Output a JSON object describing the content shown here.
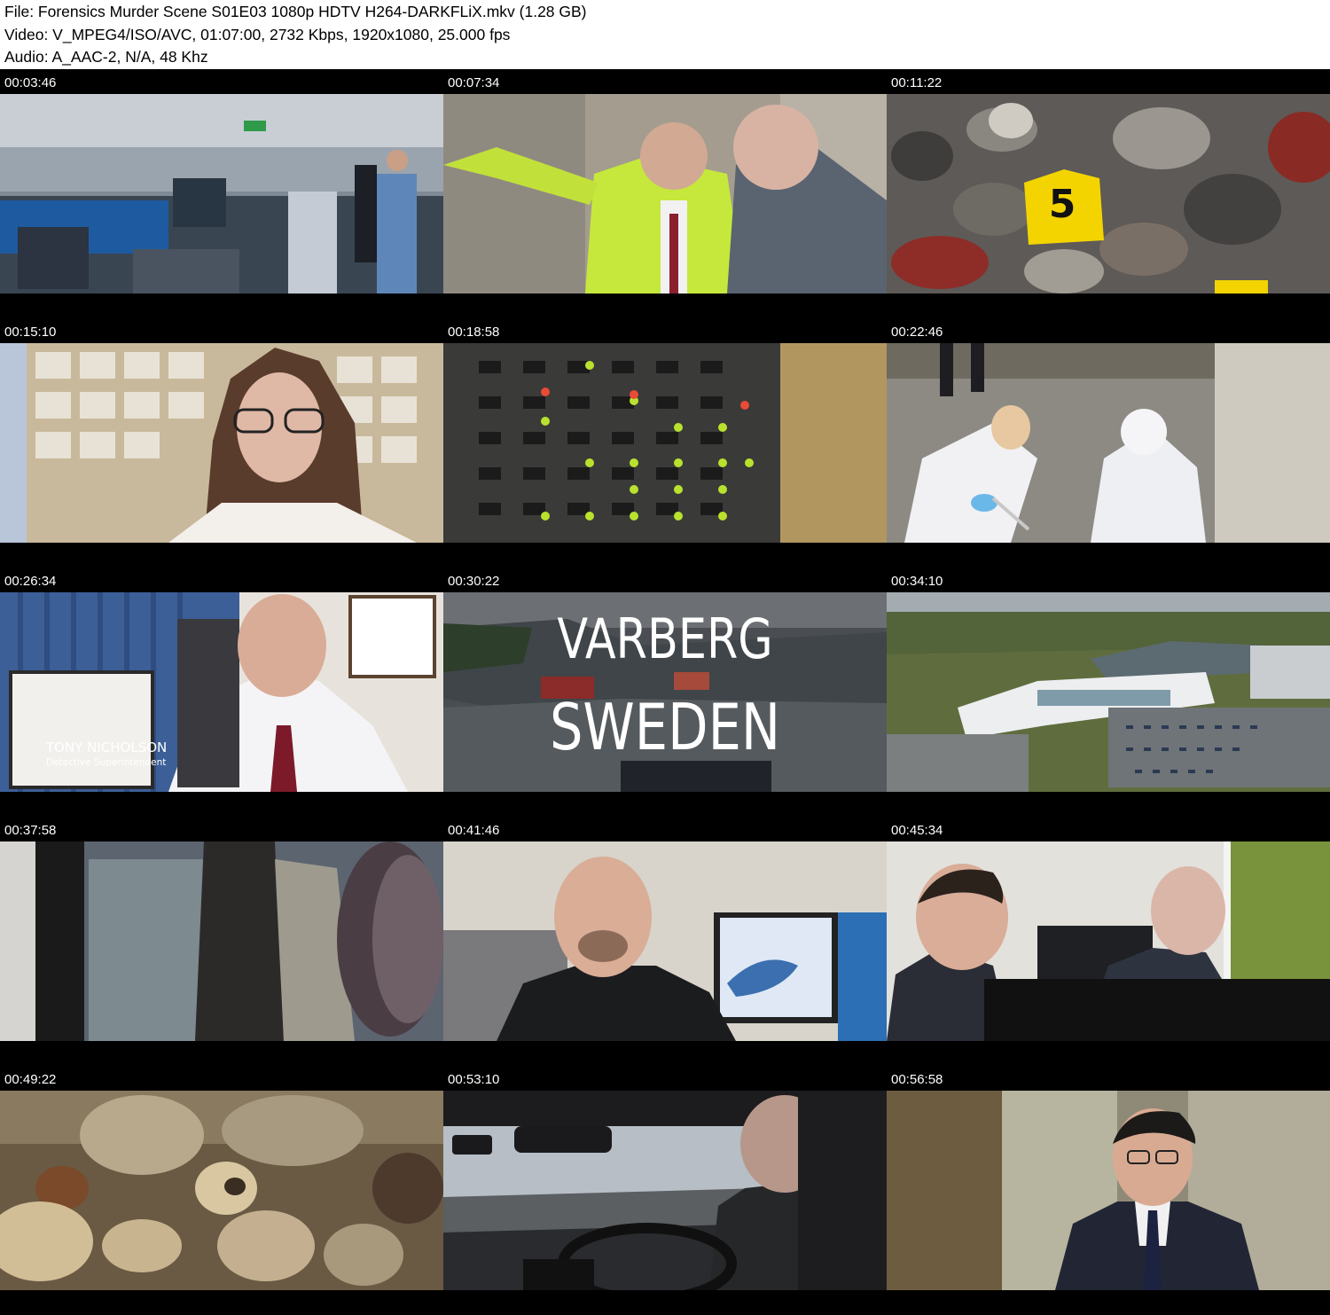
{
  "header": {
    "file_line": "File: Forensics Murder Scene S01E03 1080p HDTV H264-DARKFLiX.mkv (1.28 GB)",
    "video_line": "Video: V_MPEG4/ISO/AVC, 01:07:00, 2732 Kbps, 1920x1080, 25.000 fps",
    "audio_line": "Audio: A_AAC-2, N/A, 48 Khz"
  },
  "thumbnails": [
    {
      "timestamp": "00:03:46",
      "scene": "office-open-plan"
    },
    {
      "timestamp": "00:07:34",
      "scene": "officer-pointing-hi-vis"
    },
    {
      "timestamp": "00:11:22",
      "scene": "evidence-marker-rubble",
      "marker": "5"
    },
    {
      "timestamp": "00:15:10",
      "scene": "woman-interview-shelves"
    },
    {
      "timestamp": "00:18:58",
      "scene": "server-lights"
    },
    {
      "timestamp": "00:22:46",
      "scene": "forensic-team-white-suits"
    },
    {
      "timestamp": "00:26:34",
      "scene": "detective-interview",
      "name": "TONY NICHOLSON",
      "role": "Detective Superintendent"
    },
    {
      "timestamp": "00:30:22",
      "scene": "aerial-harbour",
      "title_1": "VARBERG",
      "title_2": "SWEDEN"
    },
    {
      "timestamp": "00:34:10",
      "scene": "aerial-building-lake"
    },
    {
      "timestamp": "00:37:58",
      "scene": "monitor-waste-chute"
    },
    {
      "timestamp": "00:41:46",
      "scene": "officer-control-room"
    },
    {
      "timestamp": "00:45:34",
      "scene": "two-men-at-monitor"
    },
    {
      "timestamp": "00:49:22",
      "scene": "bone-fragments-closeup"
    },
    {
      "timestamp": "00:53:10",
      "scene": "man-driving-car"
    },
    {
      "timestamp": "00:56:58",
      "scene": "man-suit-interview"
    }
  ],
  "colors": {
    "sheet_background": "#000000",
    "header_background": "#ffffff",
    "timestamp_text": "#ffffff",
    "evidence_marker": "#f3d400"
  }
}
